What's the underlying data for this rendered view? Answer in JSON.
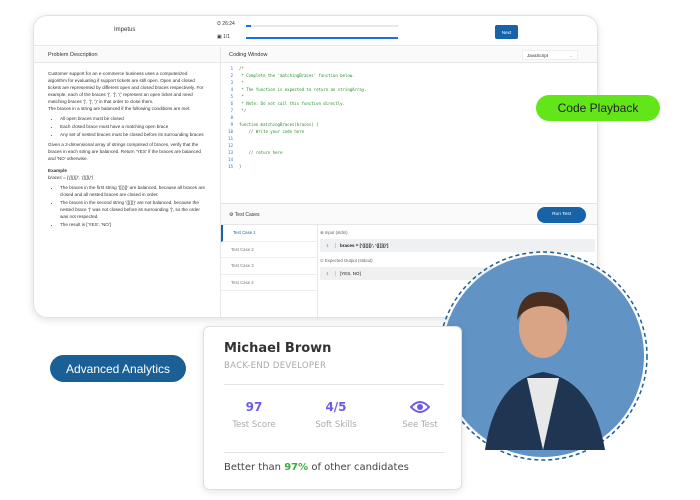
{
  "header": {
    "logo": "Impetus",
    "timer": "26:24",
    "timer_progress": 0.03,
    "question_count": "1/1",
    "question_progress": 1.0,
    "next_label": "Next"
  },
  "problem": {
    "title": "Problem Description",
    "paragraph1": "Customer support for an e-commerce business uses a computerized algorithm for evaluating if support tickets are still open. Open and closed tickets are represented by different open and closed braces respectively. For example, each of the braces '{', '[', '(' represent an open ticket and need matching braces '}', ']', ')' in that order to close them.",
    "paragraph2": "The braces in a string are balanced if the following conditions are met:",
    "conditions": [
      "All open braces must be closed",
      "Each closed brace must have a matching open brace",
      "Any set of nested braces must be closed before its surrounding braces"
    ],
    "paragraph3": "Given a 2-dimensional array of strings comprised of braces, verify that the braces in each string are balanced. Return 'YES' if the braces are balanced and 'NO' otherwise.",
    "example_title": "Example",
    "example_value": "braces = ['{[()]}', '{[(])}']",
    "explanations": [
      "The braces in the first string '{[()]}' are balanced, because all braces are closed and all nested braces are closed in order.",
      "The braces in the second string '{[(])}' are not balanced, because the nested brace '(' was not closed before its surrounding '[', so the order was not respected.",
      "The result is ['YES', 'NO']"
    ]
  },
  "coding": {
    "title": "Coding Window",
    "language": "JavaScript",
    "lines": [
      "/*",
      " * Complete the 'matchingBraces' function below.",
      " *",
      " * The function is expected to return an stringArray.",
      " *",
      " * Note: Do not call this function directly.",
      " */",
      "",
      "function matchingBraces(braces) {",
      "    // Write your code here",
      "",
      "",
      "    // return here",
      "",
      "}"
    ]
  },
  "tests": {
    "title": "Test Cases",
    "run_label": "Run Test",
    "tabs": [
      "Test Case 1",
      "Test Case 2",
      "Test Case 3",
      "Test Case 4"
    ],
    "input_label": "Input (stdin)",
    "input_value": "braces = ['{[()]}', '{[(])}']",
    "output_label": "Expected Output (stdout)",
    "output_value": "[YES, NO]"
  },
  "badges": {
    "code_playback": "Code Playback",
    "advanced_analytics": "Advanced Analytics",
    "playback_color": "#62e61a",
    "analytics_color": "#1a5f96"
  },
  "candidate": {
    "name": "Michael Brown",
    "role": "BACK-END DEVELOPER",
    "stats": [
      {
        "value": "97",
        "label": "Test Score"
      },
      {
        "value": "4/5",
        "label": "Soft Skills"
      },
      {
        "value": "",
        "label": "See Test"
      }
    ],
    "footer_prefix": "Better than ",
    "footer_highlight": "97%",
    "footer_suffix": " of other candidates"
  }
}
